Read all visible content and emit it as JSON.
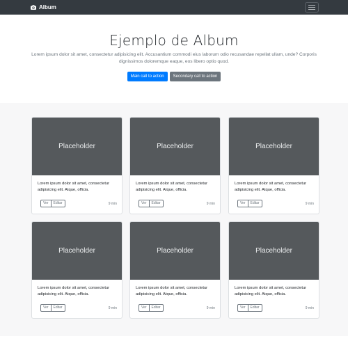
{
  "navbar": {
    "brand": "Album",
    "brand_icon": "camera-icon",
    "toggler_icon": "hamburger-icon"
  },
  "jumbotron": {
    "heading": "Ejemplo de Album",
    "lead": "Lorem ipsum dolor sit amet, consectetur adipisicing elit. Accusantium commodi eius laborum odio recusandae repellat ullam, unde? Corporis dignissimos doloremque eaque, eos libero optio quod.",
    "primary_cta": "Main call to action",
    "secondary_cta": "Secondary call to action"
  },
  "cards": [
    {
      "thumb": "Placeholder",
      "text": "Lorem ipsum dolor sit amet, consectetur adipisicing elit. Atque, officia.",
      "view": "Ver",
      "edit": "Editar",
      "time": "9 min"
    },
    {
      "thumb": "Placeholder",
      "text": "Lorem ipsum dolor sit amet, consectetur adipisicing elit. Atque, officia.",
      "view": "Ver",
      "edit": "Editar",
      "time": "9 min"
    },
    {
      "thumb": "Placeholder",
      "text": "Lorem ipsum dolor sit amet, consectetur adipisicing elit. Atque, officia.",
      "view": "Ver",
      "edit": "Editar",
      "time": "9 min"
    },
    {
      "thumb": "Placeholder",
      "text": "Lorem ipsum dolor sit amet, consectetur adipisicing elit. Atque, officia.",
      "view": "Ver",
      "edit": "Editar",
      "time": "9 min"
    },
    {
      "thumb": "Placeholder",
      "text": "Lorem ipsum dolor sit amet, consectetur adipisicing elit. Atque, officia.",
      "view": "Ver",
      "edit": "Editar",
      "time": "9 min"
    },
    {
      "thumb": "Placeholder",
      "text": "Lorem ipsum dolor sit amet, consectetur adipisicing elit. Atque, officia.",
      "view": "Ver",
      "edit": "Editar",
      "time": "9 min"
    }
  ],
  "colors": {
    "navbar_bg": "#343a40",
    "primary": "#007bff",
    "secondary": "#6c757d",
    "thumb_bg": "#55595c",
    "album_bg": "#f7f7f8"
  }
}
